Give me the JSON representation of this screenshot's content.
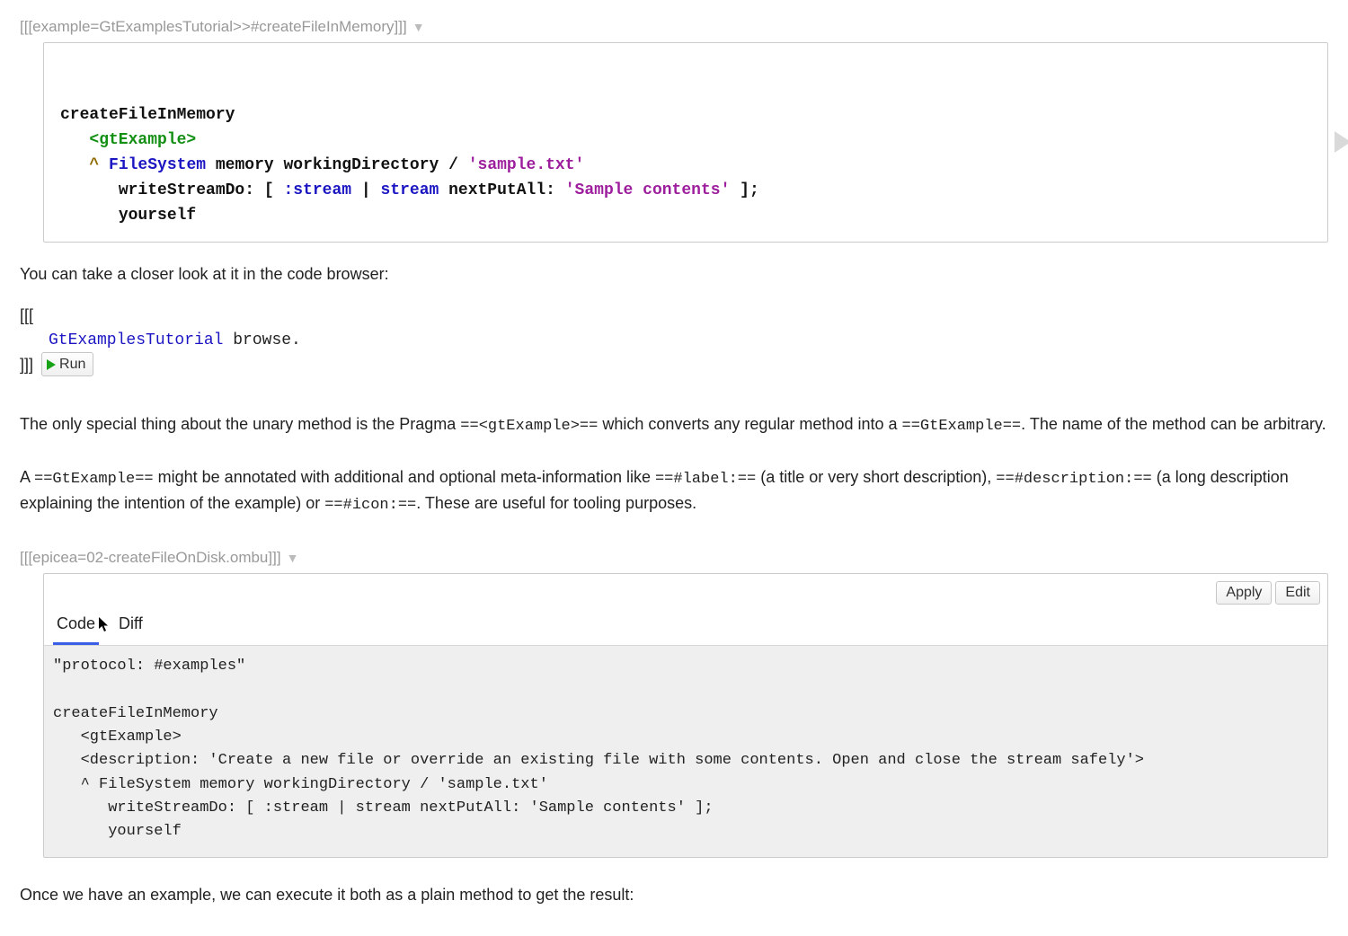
{
  "block1": {
    "annotation_label": "[[[example=GtExamplesTutorial>>#createFileInMemory]]]",
    "triangle_glyph": "▼",
    "code": {
      "method_name": "createFileInMemory",
      "pragma": "<gtExample>",
      "caret": "^",
      "filesystem": "FileSystem",
      "rest_line1": " memory workingDirectory / ",
      "string1": "'sample.txt'",
      "write_kw": "writeStreamDo:",
      "between1": " [ ",
      "stream_arg": ":stream",
      "between2": " | ",
      "stream_var": "stream",
      "nextputall_kw": " nextPutAll: ",
      "string2": "'Sample contents'",
      "after2": " ];",
      "yourself": "yourself"
    }
  },
  "para_intro": "You can take a closer look at it in the code browser:",
  "bracket_block": {
    "open": "[[[",
    "class_name": "GtExamplesTutorial",
    "method_call": " browse.",
    "close": "]]]",
    "run_label": "Run"
  },
  "para2_a": "The only special thing about the unary method is the Pragma ",
  "para2_code1": "==<gtExample>==",
  "para2_b": " which converts any regular method into a ",
  "para2_code2": "==GtExample==",
  "para2_c": ". The name of the method can be arbitrary.",
  "para3_a": "A ",
  "para3_code1": "==GtExample==",
  "para3_b": " might be annotated with additional and optional meta-information like ",
  "para3_code2": "==#label:==",
  "para3_c": " (a title or very short description), ",
  "para3_code3": "==#description:==",
  "para3_d": " (a long description explaining the intention of the example) or ",
  "para3_code4": "==#icon:==",
  "para3_e": ". These are useful for tooling purposes.",
  "block2": {
    "annotation_label": "[[[epicea=02-createFileOnDisk.ombu]]]",
    "triangle_glyph": "▼",
    "apply_label": "Apply",
    "edit_label": "Edit",
    "tab_code": "Code",
    "tab_diff": "Diff",
    "body": "\"protocol: #examples\"\n\ncreateFileInMemory\n   <gtExample>\n   <description: 'Create a new file or override an existing file with some contents. Open and close the stream safely'>\n   ^ FileSystem memory workingDirectory / 'sample.txt'\n      writeStreamDo: [ :stream | stream nextPutAll: 'Sample contents' ];\n      yourself"
  },
  "para_outro": "Once we have an example, we can execute it both as a plain method to get the result:"
}
